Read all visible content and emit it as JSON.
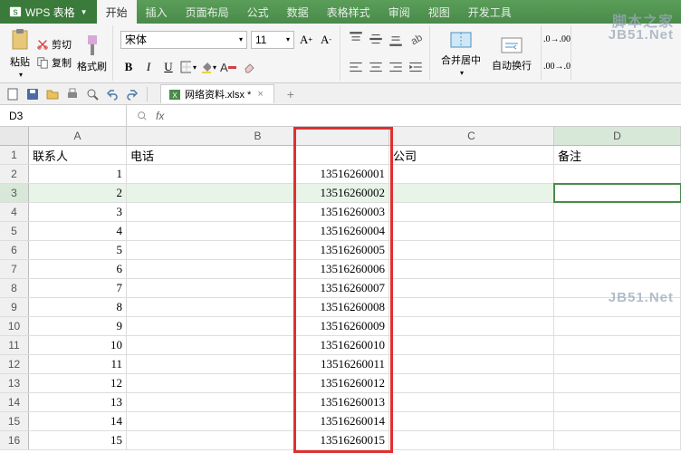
{
  "app": {
    "name": "WPS 表格"
  },
  "menu": {
    "tabs": [
      "开始",
      "插入",
      "页面布局",
      "公式",
      "数据",
      "表格样式",
      "审阅",
      "视图",
      "开发工具"
    ],
    "active": 0
  },
  "ribbon": {
    "paste": "粘贴",
    "cut": "剪切",
    "copy": "复制",
    "format_painter": "格式刷",
    "font_name": "宋体",
    "font_size": "11",
    "merge_center": "合并居中",
    "wrap_text": "自动换行"
  },
  "qat": {
    "doc_name": "网络资料.xlsx *"
  },
  "namebox": {
    "ref": "D3"
  },
  "columns": [
    "A",
    "B",
    "C",
    "D"
  ],
  "headers": {
    "A": "联系人",
    "B": "电话",
    "C": "公司",
    "D": "备注"
  },
  "data_rows": [
    {
      "n": 1,
      "a": "1",
      "b": "13516260001"
    },
    {
      "n": 2,
      "a": "2",
      "b": "13516260002"
    },
    {
      "n": 3,
      "a": "3",
      "b": "13516260003"
    },
    {
      "n": 4,
      "a": "4",
      "b": "13516260004"
    },
    {
      "n": 5,
      "a": "5",
      "b": "13516260005"
    },
    {
      "n": 6,
      "a": "6",
      "b": "13516260006"
    },
    {
      "n": 7,
      "a": "7",
      "b": "13516260007"
    },
    {
      "n": 8,
      "a": "8",
      "b": "13516260008"
    },
    {
      "n": 9,
      "a": "9",
      "b": "13516260009"
    },
    {
      "n": 10,
      "a": "10",
      "b": "13516260010"
    },
    {
      "n": 11,
      "a": "11",
      "b": "13516260011"
    },
    {
      "n": 12,
      "a": "12",
      "b": "13516260012"
    },
    {
      "n": 13,
      "a": "13",
      "b": "13516260013"
    },
    {
      "n": 14,
      "a": "14",
      "b": "13516260014"
    },
    {
      "n": 15,
      "a": "15",
      "b": "13516260015"
    }
  ],
  "active_cell": "D3",
  "watermark_top": "脚本之家",
  "watermark": "JB51.Net"
}
